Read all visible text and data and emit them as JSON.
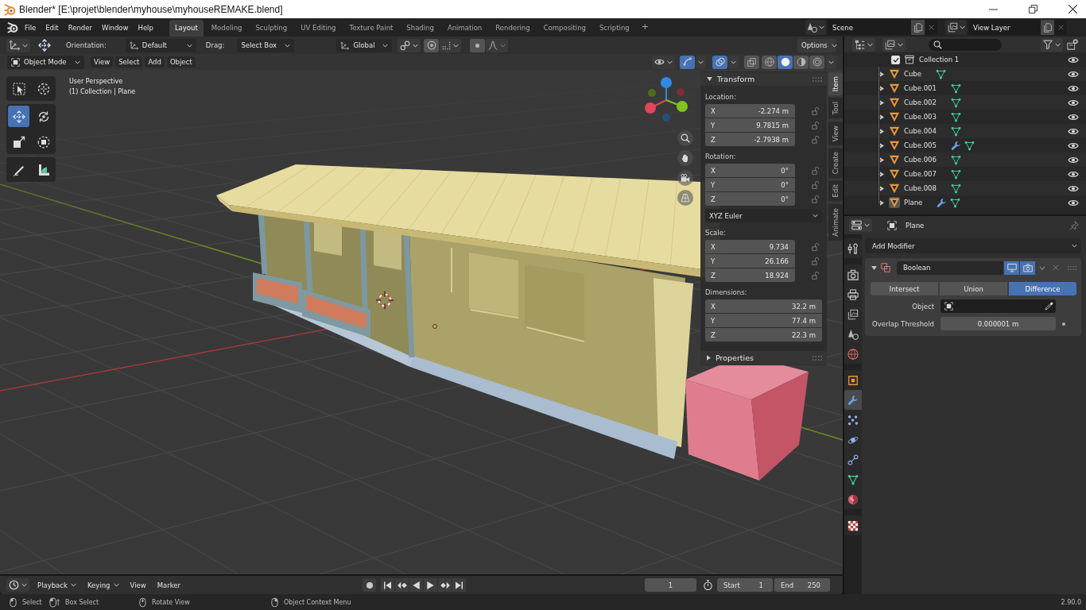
{
  "window": {
    "title": "Blender* [E:\\projet\\blender\\myhouse\\myhouseREMAKE.blend]"
  },
  "topbar": {
    "menus": [
      "File",
      "Edit",
      "Render",
      "Window",
      "Help"
    ],
    "workspaces": [
      {
        "label": "Layout",
        "selected": true
      },
      {
        "label": "Modeling",
        "selected": false
      },
      {
        "label": "Sculpting",
        "selected": false
      },
      {
        "label": "UV Editing",
        "selected": false
      },
      {
        "label": "Texture Paint",
        "selected": false
      },
      {
        "label": "Shading",
        "selected": false
      },
      {
        "label": "Animation",
        "selected": false
      },
      {
        "label": "Rendering",
        "selected": false
      },
      {
        "label": "Compositing",
        "selected": false
      },
      {
        "label": "Scripting",
        "selected": false
      }
    ],
    "add_workspace": "+",
    "scene": "Scene",
    "view_layer": "View Layer"
  },
  "tool_header": {
    "orientation_label": "Orientation:",
    "orientation": "Default",
    "drag_label": "Drag:",
    "drag": "Select Box",
    "transform_orientation": "Global",
    "options": "Options"
  },
  "view_header": {
    "mode": "Object Mode",
    "menus": [
      "View",
      "Select",
      "Add",
      "Object"
    ],
    "show_gizmo": true,
    "show_overlays": true,
    "xray": false,
    "shading": [
      {
        "kind": "wireframe",
        "selected": false
      },
      {
        "kind": "solid",
        "selected": true
      },
      {
        "kind": "material",
        "selected": false
      },
      {
        "kind": "rendered",
        "selected": false
      }
    ]
  },
  "toolbar": {
    "groups": [
      {
        "tools": [
          {
            "kind": "select_box",
            "selected": false
          },
          {
            "kind": "cursor",
            "selected": false
          }
        ]
      },
      {
        "tools": [
          {
            "kind": "move",
            "selected": true
          },
          {
            "kind": "rotate",
            "selected": false
          },
          {
            "kind": "scale",
            "selected": false
          },
          {
            "kind": "transform",
            "selected": false
          }
        ]
      },
      {
        "tools": [
          {
            "kind": "annotate",
            "selected": false
          },
          {
            "kind": "measure",
            "selected": false
          }
        ]
      }
    ]
  },
  "viewport": {
    "view_name": "User Perspective",
    "context": "(1) Collection | Plane"
  },
  "sidebar": {
    "tabs": [
      {
        "label": "Item",
        "selected": true
      },
      {
        "label": "Tool",
        "selected": false
      },
      {
        "label": "View",
        "selected": false
      },
      {
        "label": "Create",
        "selected": false
      },
      {
        "label": "Edit",
        "selected": false
      },
      {
        "label": "Animate",
        "selected": false
      }
    ],
    "panels": [
      {
        "title": "Transform",
        "expanded": true,
        "rows": [
          {
            "kind": "vector",
            "label": "Location:",
            "lockable": true,
            "fields": [
              {
                "axis": "X",
                "value": "-2.274 m"
              },
              {
                "axis": "Y",
                "value": "9.7815 m"
              },
              {
                "axis": "Z",
                "value": "-2.7938 m"
              }
            ]
          },
          {
            "kind": "vector",
            "label": "Rotation:",
            "lockable": true,
            "fields": [
              {
                "axis": "X",
                "value": "0°"
              },
              {
                "axis": "Y",
                "value": "0°"
              },
              {
                "axis": "Z",
                "value": "0°"
              }
            ]
          },
          {
            "kind": "dropdown",
            "value": "XYZ Euler"
          },
          {
            "kind": "vector",
            "label": "Scale:",
            "lockable": true,
            "fields": [
              {
                "axis": "X",
                "value": "9.734"
              },
              {
                "axis": "Y",
                "value": "26.166"
              },
              {
                "axis": "Z",
                "value": "18.924"
              }
            ]
          },
          {
            "kind": "vector",
            "label": "Dimensions:",
            "lockable": false,
            "fields": [
              {
                "axis": "X",
                "value": "32.2 m"
              },
              {
                "axis": "Y",
                "value": "77.4 m"
              },
              {
                "axis": "Z",
                "value": "22.3 m"
              }
            ]
          }
        ]
      },
      {
        "title": "Properties",
        "expanded": false
      }
    ]
  },
  "outliner": {
    "tree": [
      {
        "label": "Collection 1",
        "checked": true,
        "visible": true,
        "children": [
          {
            "label": "Cube",
            "expanded": false,
            "selected": false,
            "modifier": false,
            "visible": true
          },
          {
            "label": "Cube.001",
            "expanded": false,
            "selected": false,
            "modifier": false,
            "visible": true
          },
          {
            "label": "Cube.002",
            "expanded": false,
            "selected": false,
            "modifier": false,
            "visible": true
          },
          {
            "label": "Cube.003",
            "expanded": false,
            "selected": false,
            "modifier": false,
            "visible": true
          },
          {
            "label": "Cube.004",
            "expanded": false,
            "selected": false,
            "modifier": false,
            "visible": true
          },
          {
            "label": "Cube.005",
            "expanded": false,
            "selected": false,
            "modifier": true,
            "visible": true
          },
          {
            "label": "Cube.006",
            "expanded": false,
            "selected": false,
            "modifier": false,
            "visible": true
          },
          {
            "label": "Cube.007",
            "expanded": false,
            "selected": false,
            "modifier": false,
            "visible": true
          },
          {
            "label": "Cube.008",
            "expanded": false,
            "selected": false,
            "modifier": false,
            "visible": true
          },
          {
            "label": "Plane",
            "expanded": false,
            "selected": true,
            "modifier": true,
            "visible": true
          }
        ]
      }
    ]
  },
  "properties": {
    "object_name": "Plane",
    "tab_groups": [
      {
        "tabs": [
          {
            "kind": "tool",
            "selected": false
          }
        ]
      },
      {
        "tabs": [
          {
            "kind": "render",
            "selected": false
          },
          {
            "kind": "output",
            "selected": false
          },
          {
            "kind": "view_layer",
            "selected": false
          },
          {
            "kind": "scene",
            "selected": false
          },
          {
            "kind": "world",
            "selected": false
          }
        ]
      },
      {
        "tabs": [
          {
            "kind": "object",
            "selected": false
          },
          {
            "kind": "modifiers",
            "selected": true
          },
          {
            "kind": "particles",
            "selected": false
          },
          {
            "kind": "physics",
            "selected": false
          },
          {
            "kind": "constraints",
            "selected": false
          },
          {
            "kind": "data",
            "selected": false
          },
          {
            "kind": "material",
            "selected": false
          }
        ]
      },
      {
        "tabs": [
          {
            "kind": "texture",
            "selected": false
          }
        ]
      }
    ],
    "add_modifier": "Add Modifier",
    "modifiers": [
      {
        "name": "Boolean",
        "expanded": true,
        "show_viewport": true,
        "show_render": true,
        "operations": [
          {
            "label": "Intersect",
            "selected": false
          },
          {
            "label": "Union",
            "selected": false
          },
          {
            "label": "Difference",
            "selected": true
          }
        ],
        "object_label": "Object",
        "threshold_label": "Overlap Threshold",
        "threshold": "0.000001 m"
      }
    ]
  },
  "timeline": {
    "menus": [
      {
        "kind": "dropdown",
        "label": "Playback"
      },
      {
        "kind": "dropdown",
        "label": "Keying"
      },
      {
        "kind": "menu",
        "label": "View"
      },
      {
        "kind": "menu",
        "label": "Marker"
      }
    ],
    "current_frame": "1",
    "start_label": "Start",
    "start": "1",
    "end_label": "End",
    "end": "250"
  },
  "status_bar": {
    "hints": [
      {
        "kind": "left_click",
        "label": "Select"
      },
      {
        "kind": "left_drag",
        "label": "Box Select"
      },
      {
        "kind": "middle_click",
        "label": "Rotate View"
      },
      {
        "kind": "right_click",
        "label": "Object Context Menu"
      }
    ],
    "version": "2.90.0"
  }
}
